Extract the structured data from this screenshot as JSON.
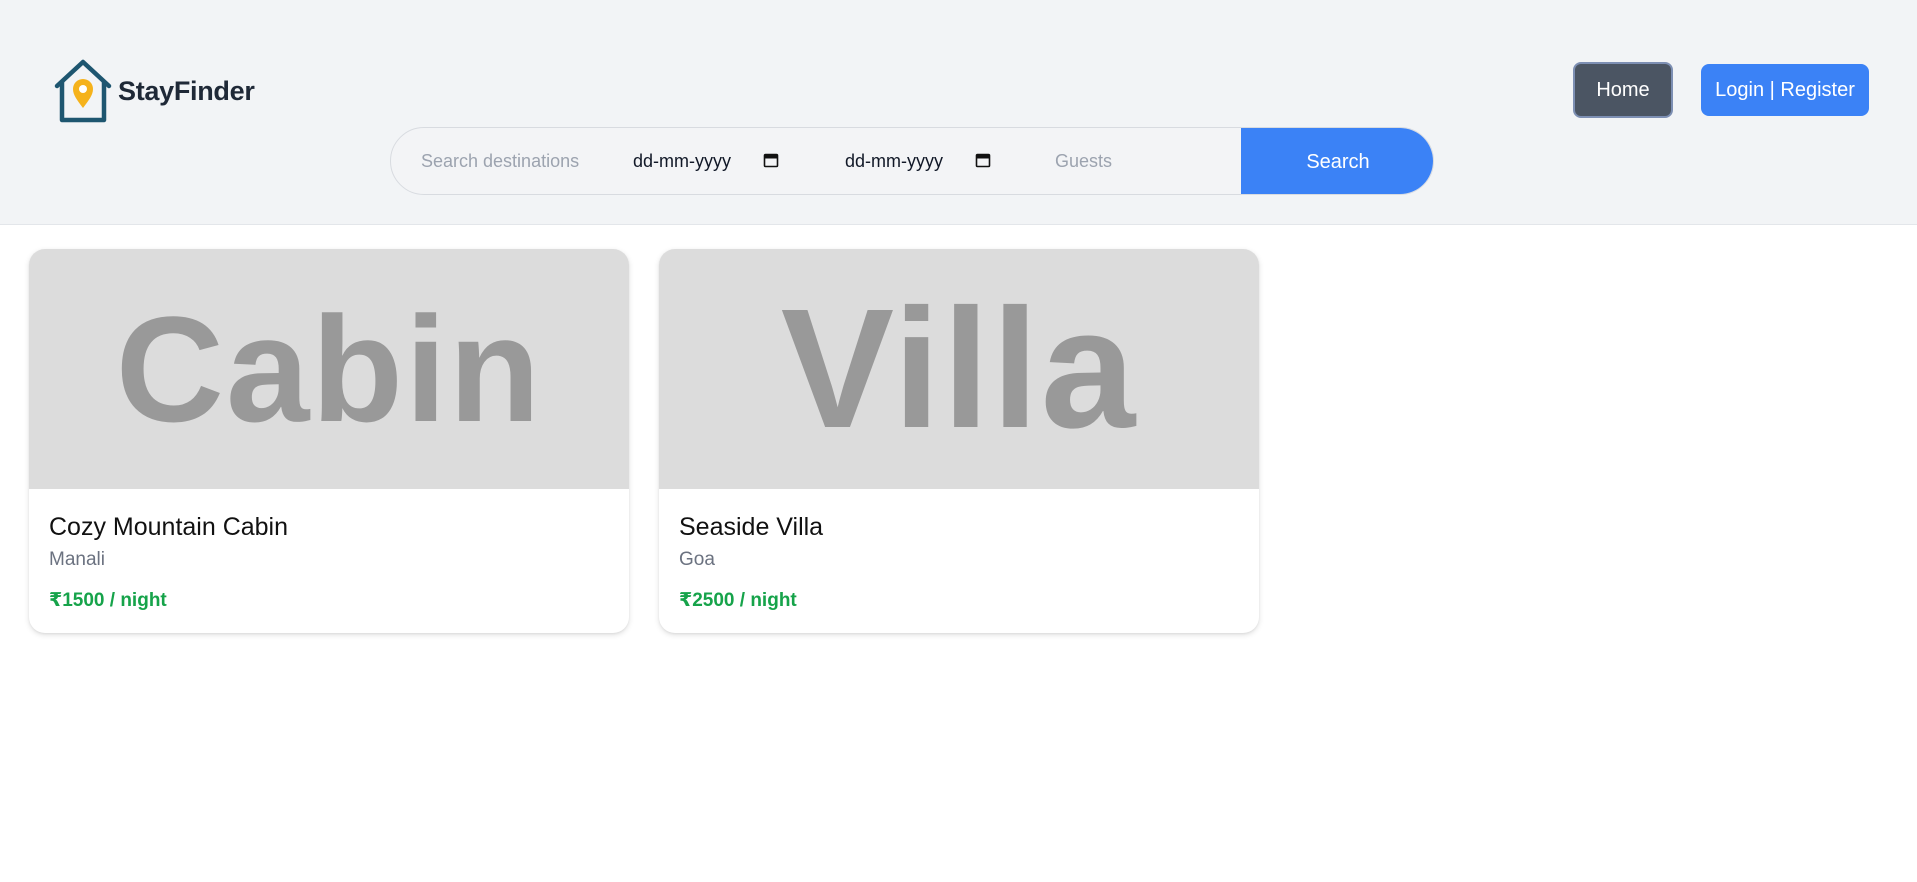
{
  "header": {
    "logo_text": "StayFinder",
    "nav": {
      "home": "Home",
      "login": "Login | Register"
    }
  },
  "search": {
    "destination_placeholder": "Search destinations",
    "checkin": "dd-mm-yyyy",
    "checkout": "dd-mm-yyyy",
    "guests_placeholder": "Guests",
    "button": "Search"
  },
  "listings": [
    {
      "image_text": "Cabin",
      "title": "Cozy Mountain Cabin",
      "location": "Manali",
      "price": "₹1500 / night"
    },
    {
      "image_text": "Villa",
      "title": "Seaside Villa",
      "location": "Goa",
      "price": "₹2500 / night"
    }
  ],
  "colors": {
    "accent": "#3b82f6",
    "home_button": "#4b5563",
    "price": "#16a34a",
    "logo_house": "#1e5670",
    "logo_pin": "#f5b21b"
  }
}
